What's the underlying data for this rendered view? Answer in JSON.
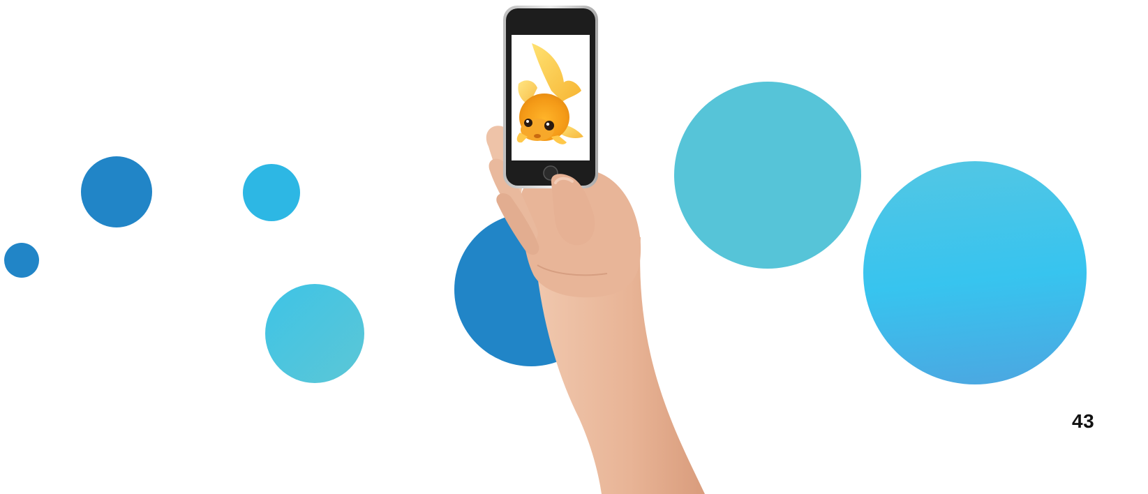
{
  "page": {
    "number": "43"
  },
  "colors": {
    "background": "#ffffff",
    "circle_dark_blue": "#2185c7",
    "circle_bright_blue": "#2db7e4",
    "circle_teal": "#56c4d8",
    "circle_sky": "#3ec4ee",
    "fish_orange": "#f4a21c",
    "skin": "#e9b79c",
    "phone_body": "#1d1d1d",
    "page_number": "#111111"
  },
  "illustration": {
    "icons": [
      "hand-holding-phone-icon",
      "goldfish-icon"
    ]
  }
}
